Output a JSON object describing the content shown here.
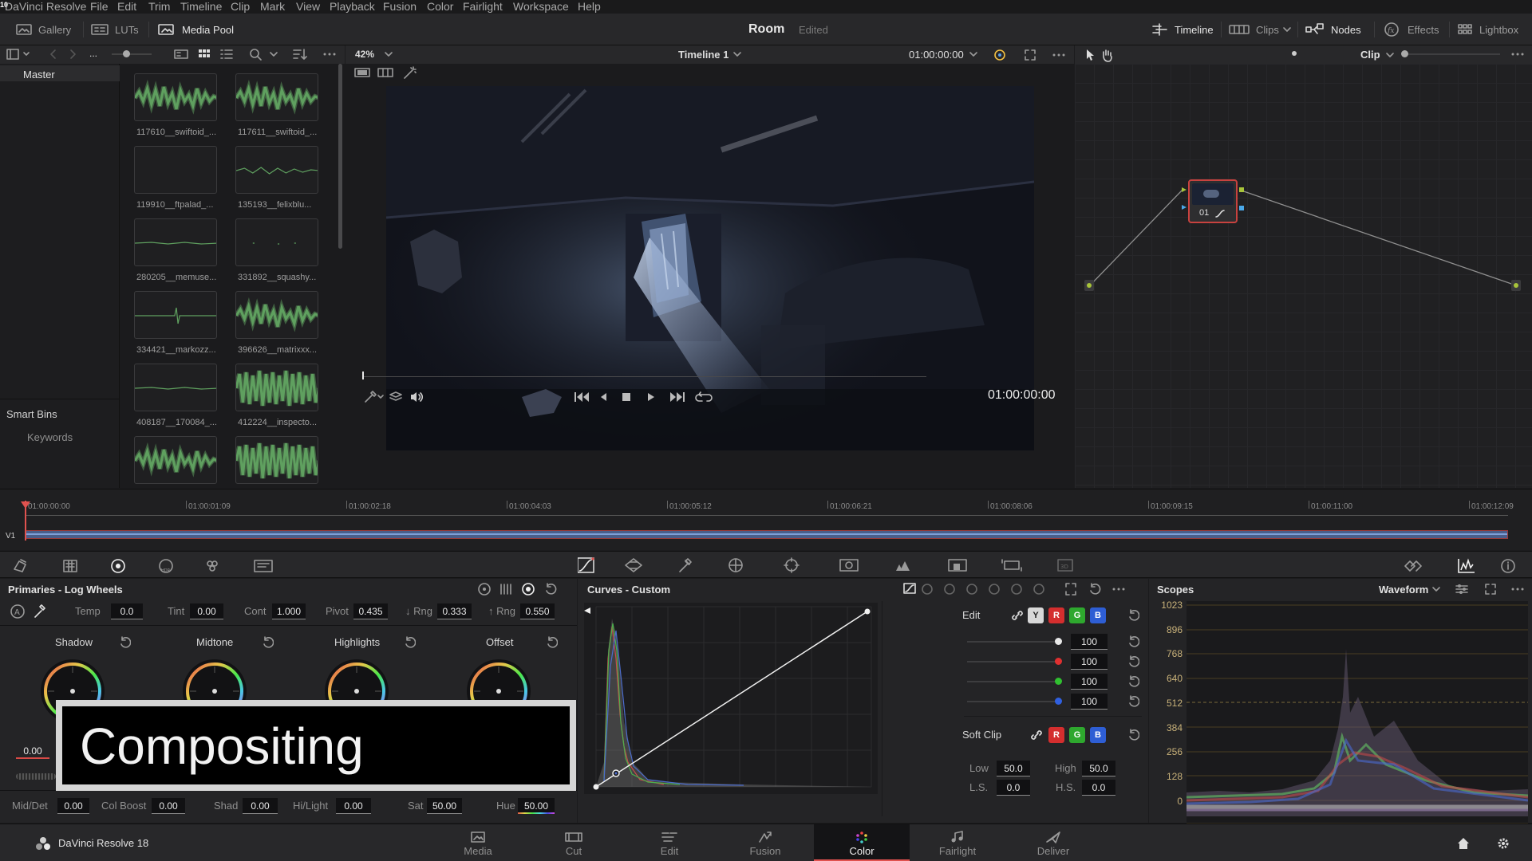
{
  "app": {
    "title": "DaVinci Resolve",
    "edition_label": "DaVinci Resolve 18"
  },
  "menu": [
    "File",
    "Edit",
    "Trim",
    "Timeline",
    "Clip",
    "Mark",
    "View",
    "Playback",
    "Fusion",
    "Color",
    "Fairlight",
    "Workspace",
    "Help"
  ],
  "toolbar": {
    "gallery": "Gallery",
    "luts": "LUTs",
    "media_pool": "Media Pool",
    "project_name": "Room",
    "project_status": "Edited",
    "timeline": "Timeline",
    "clips": "Clips",
    "nodes": "Nodes",
    "effects": "Effects",
    "lightbox": "Lightbox"
  },
  "viewer": {
    "zoom": "42%",
    "timeline_name": "Timeline 1",
    "timecode_top": "01:00:00:00",
    "timecode": "01:00:00:00",
    "mode": "Clip"
  },
  "mediapool": {
    "path": "...",
    "bin": "Master",
    "smart_bins": "Smart Bins",
    "keywords": "Keywords",
    "clips": [
      {
        "name": "117610__swiftoid_...",
        "wave": "dense"
      },
      {
        "name": "117611__swiftoid_...",
        "wave": "dense"
      },
      {
        "name": "119910__ftpalad_...",
        "wave": "empty"
      },
      {
        "name": "135193__felixblu...",
        "wave": "thin"
      },
      {
        "name": "280205__memuse...",
        "wave": "line"
      },
      {
        "name": "331892__squashy...",
        "wave": "dots"
      },
      {
        "name": "334421__markozz...",
        "wave": "spike"
      },
      {
        "name": "396626__matrixxx...",
        "wave": "dense"
      },
      {
        "name": "408187__170084_...",
        "wave": "line"
      },
      {
        "name": "412224__inspecto...",
        "wave": "full"
      },
      {
        "name": "",
        "wave": "dense"
      },
      {
        "name": "",
        "wave": "full"
      }
    ]
  },
  "timeline": {
    "track": "V1",
    "ticks": [
      "01:00:00:00",
      "01:00:01:09",
      "01:00:02:18",
      "01:00:04:03",
      "01:00:05:12",
      "01:00:06:21",
      "01:00:08:06",
      "01:00:09:15",
      "01:00:11:00",
      "01:00:12:09"
    ]
  },
  "node": {
    "label": "01"
  },
  "primaries": {
    "title": "Primaries - Log Wheels",
    "temp_label": "Temp",
    "temp": "0.0",
    "tint_label": "Tint",
    "tint": "0.00",
    "cont_label": "Cont",
    "cont": "1.000",
    "pivot_label": "Pivot",
    "pivot": "0.435",
    "lrng_label": "↓ Rng",
    "lrng": "0.333",
    "hrng_label": "↑ Rng",
    "hrng": "0.550",
    "wheels": [
      "Shadow",
      "Midtone",
      "Highlights",
      "Offset"
    ],
    "wheel_value": "0.00",
    "middet_label": "Mid/Det",
    "middet": "0.00",
    "colboost_label": "Col Boost",
    "colboost": "0.00",
    "shad_label": "Shad",
    "shad": "0.00",
    "hilight_label": "Hi/Light",
    "hilight": "0.00",
    "sat_label": "Sat",
    "sat": "50.00",
    "hue_label": "Hue",
    "hue": "50.00"
  },
  "overlay": {
    "text": "Compositing"
  },
  "curves": {
    "title": "Curves - Custom",
    "edit": "Edit",
    "y_chip": "Y",
    "r_chip": "R",
    "g_chip": "G",
    "b_chip": "B",
    "edit_values": [
      "100",
      "100",
      "100",
      "100"
    ],
    "soft_clip": "Soft Clip",
    "low_label": "Low",
    "low": "50.0",
    "high_label": "High",
    "high": "50.0",
    "ls_label": "L.S.",
    "ls": "0.0",
    "hs_label": "H.S.",
    "hs": "0.0"
  },
  "scopes": {
    "title": "Scopes",
    "mode": "Waveform",
    "scale": [
      "1023",
      "896",
      "768",
      "640",
      "512",
      "384",
      "256",
      "128",
      "0"
    ]
  },
  "pages": [
    {
      "label": "Media"
    },
    {
      "label": "Cut"
    },
    {
      "label": "Edit"
    },
    {
      "label": "Fusion"
    },
    {
      "label": "Color"
    },
    {
      "label": "Fairlight"
    },
    {
      "label": "Deliver"
    }
  ],
  "colors": {
    "accent": "#e0524f",
    "waveform_green": "#5fa05f",
    "panel": "#28282a",
    "background": "#1b1b1d"
  }
}
